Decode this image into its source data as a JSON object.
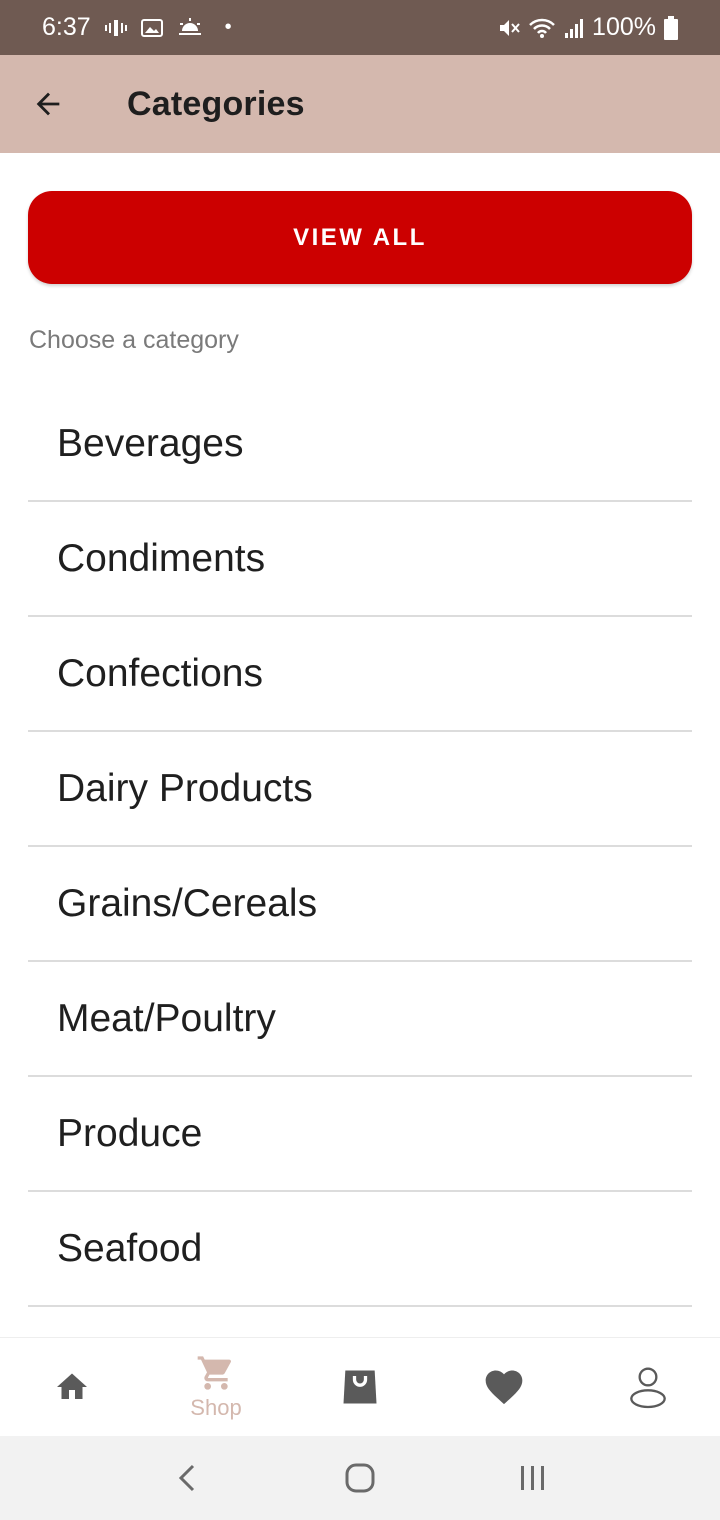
{
  "status_bar": {
    "time": "6:37",
    "battery": "100%"
  },
  "app_bar": {
    "title": "Categories",
    "back_icon": "arrow-left-icon"
  },
  "view_all_label": "VIEW ALL",
  "choose_label": "Choose a category",
  "categories": [
    "Beverages",
    "Condiments",
    "Confections",
    "Dairy Products",
    "Grains/Cereals",
    "Meat/Poultry",
    "Produce",
    "Seafood"
  ],
  "bottom_nav": {
    "shop_label": "Shop",
    "items": [
      "home-icon",
      "cart-icon",
      "shopping-bag-icon",
      "heart-icon",
      "user-icon"
    ]
  },
  "colors": {
    "status_bar": "#6f5a52",
    "app_bar": "#d4b8ae",
    "accent": "#cc0000",
    "nav_active": "#d4b8ae"
  }
}
